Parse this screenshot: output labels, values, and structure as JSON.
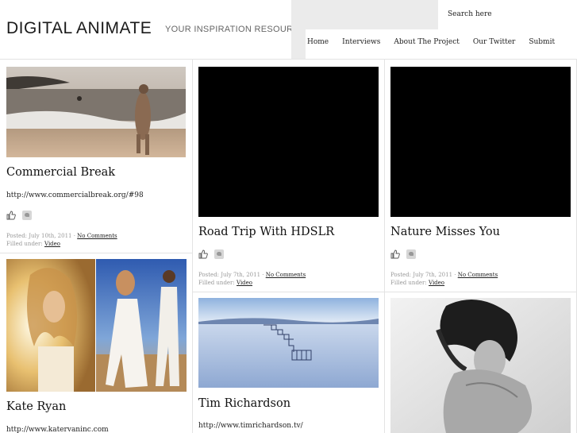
{
  "header": {
    "logo": "DIGITAL ANIMATE",
    "tagline": "YOUR INSPIRATION RESOURCE",
    "search_placeholder": "Search here"
  },
  "nav": [
    "Home",
    "Interviews",
    "About The Project",
    "Our Twitter",
    "Submit"
  ],
  "posts": [
    {
      "title": "Commercial Break",
      "url": "http://www.commercialbreak.org/#98",
      "posted_prefix": "Posted: July 10th, 2011",
      "comments": "No Comments",
      "filed_prefix": "Filled under:",
      "category": "Video"
    },
    {
      "title": "Road Trip With HDSLR",
      "posted_prefix": "Posted: July 7th, 2011",
      "comments": "No Comments",
      "filed_prefix": "Filled under:",
      "category": "Video"
    },
    {
      "title": "Nature Misses You",
      "posted_prefix": "Posted: July 7th, 2011",
      "comments": "No Comments",
      "filed_prefix": "Filled under:",
      "category": "Video"
    },
    {
      "title": "Kate Ryan",
      "url": "http://www.katervaninc.com"
    },
    {
      "title": "Tim Richardson",
      "url": "http://www.timrichardson.tv/"
    }
  ],
  "icons": [
    "like-icon",
    "twitter-icon"
  ],
  "colors": {
    "video_placeholder": "#000000",
    "header_gray": "#ebebeb",
    "divider": "#e3e3e3"
  }
}
